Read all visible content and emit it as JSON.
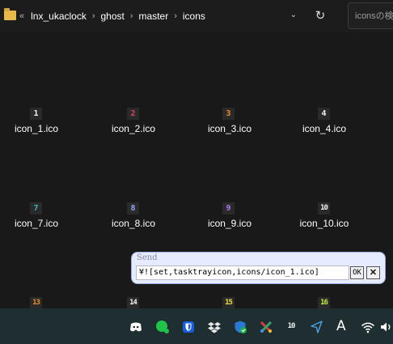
{
  "breadcrumb": {
    "more": "«",
    "items": [
      "lnx_ukaclock",
      "ghost",
      "master",
      "icons"
    ],
    "separator": "›"
  },
  "search": {
    "placeholder": "iconsの検"
  },
  "files": [
    {
      "name": "icon_1.ico",
      "glyph": "1",
      "color": "#f0f0f0"
    },
    {
      "name": "icon_2.ico",
      "glyph": "2",
      "color": "#e0405a"
    },
    {
      "name": "icon_3.ico",
      "glyph": "3",
      "color": "#f08c28"
    },
    {
      "name": "icon_4.ico",
      "glyph": "4",
      "color": "#f0f0f0"
    },
    {
      "name": "icon_7.ico",
      "glyph": "7",
      "color": "#3ab4a8"
    },
    {
      "name": "icon_8.ico",
      "glyph": "8",
      "color": "#8ea4f0"
    },
    {
      "name": "icon_9.ico",
      "glyph": "9",
      "color": "#b078f0"
    },
    {
      "name": "icon_10.ico",
      "glyph": "10",
      "color": "#f0f0f0"
    },
    {
      "name": "",
      "glyph": "13",
      "color": "#f08c28"
    },
    {
      "name": "",
      "glyph": "14",
      "color": "#f0f0f0"
    },
    {
      "name": "",
      "glyph": "15",
      "color": "#f0e040"
    },
    {
      "name": "",
      "glyph": "16",
      "color": "#c0f040"
    }
  ],
  "send_dialog": {
    "title": "Send",
    "command": "¥![set,tasktrayicon,icons/icon_1.ico]",
    "ok_label": "OK",
    "close_label": "✕"
  },
  "taskbar": {
    "icons": [
      "discord-icon",
      "line-icon",
      "bitwarden-icon",
      "dropbox-icon",
      "defender-icon",
      "snipping-tool-icon",
      "ukaclock-icon",
      "location-icon",
      "ime-icon",
      "wifi-icon",
      "volume-icon"
    ],
    "ukaclock_glyph": "10",
    "ime_text": "A"
  }
}
